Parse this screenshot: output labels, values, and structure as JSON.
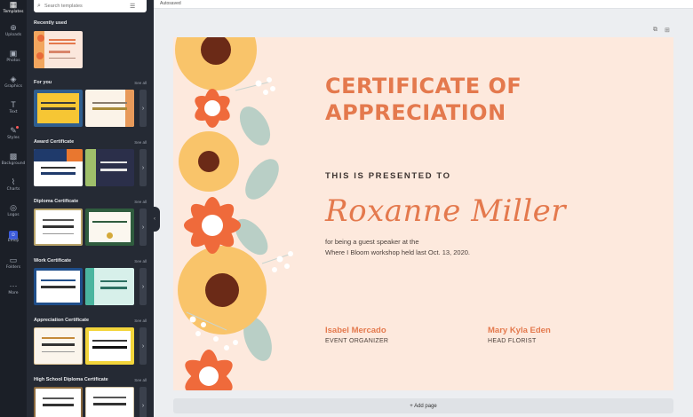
{
  "rail": {
    "items": [
      {
        "label": "Templates",
        "icon": "layout-icon"
      },
      {
        "label": "Uploads",
        "icon": "upload-icon"
      },
      {
        "label": "Photos",
        "icon": "image-icon"
      },
      {
        "label": "Graphics",
        "icon": "shapes-icon"
      },
      {
        "label": "Text",
        "icon": "text-icon"
      },
      {
        "label": "Styles",
        "icon": "palette-icon"
      },
      {
        "label": "Background",
        "icon": "pattern-icon"
      },
      {
        "label": "Charts",
        "icon": "chart-icon"
      },
      {
        "label": "Logos",
        "icon": "logo-icon"
      },
      {
        "label": "Emoji",
        "icon": "emoji-icon"
      },
      {
        "label": "Folders",
        "icon": "folder-icon"
      },
      {
        "label": "More",
        "icon": "more-icon"
      }
    ]
  },
  "panel": {
    "search_placeholder": "Search templates",
    "see_all": "See all",
    "sections": [
      {
        "title": "Recently used"
      },
      {
        "title": "For you"
      },
      {
        "title": "Award Certificate"
      },
      {
        "title": "Diploma Certificate"
      },
      {
        "title": "Work Certificate"
      },
      {
        "title": "Appreciation Certificate"
      },
      {
        "title": "High School Diploma Certificate"
      }
    ]
  },
  "topbar": {
    "label": "Autosaved"
  },
  "certificate": {
    "title_line1": "CERTIFICATE OF",
    "title_line2": "APPRECIATION",
    "presented": "THIS IS PRESENTED TO",
    "recipient": "Roxanne Miller",
    "desc_line1": "for being a guest speaker at the",
    "desc_line2": "Where I Bloom workshop held last Oct. 13, 2020.",
    "signer1_name": "Isabel Mercado",
    "signer1_role": "EVENT ORGANIZER",
    "signer2_name": "Mary Kyla Eden",
    "signer2_role": "HEAD FLORIST"
  },
  "add_page": "+ Add page",
  "colors": {
    "accent": "#e4794d",
    "cert_bg": "#fde9dd",
    "panel_bg": "#252a34"
  }
}
